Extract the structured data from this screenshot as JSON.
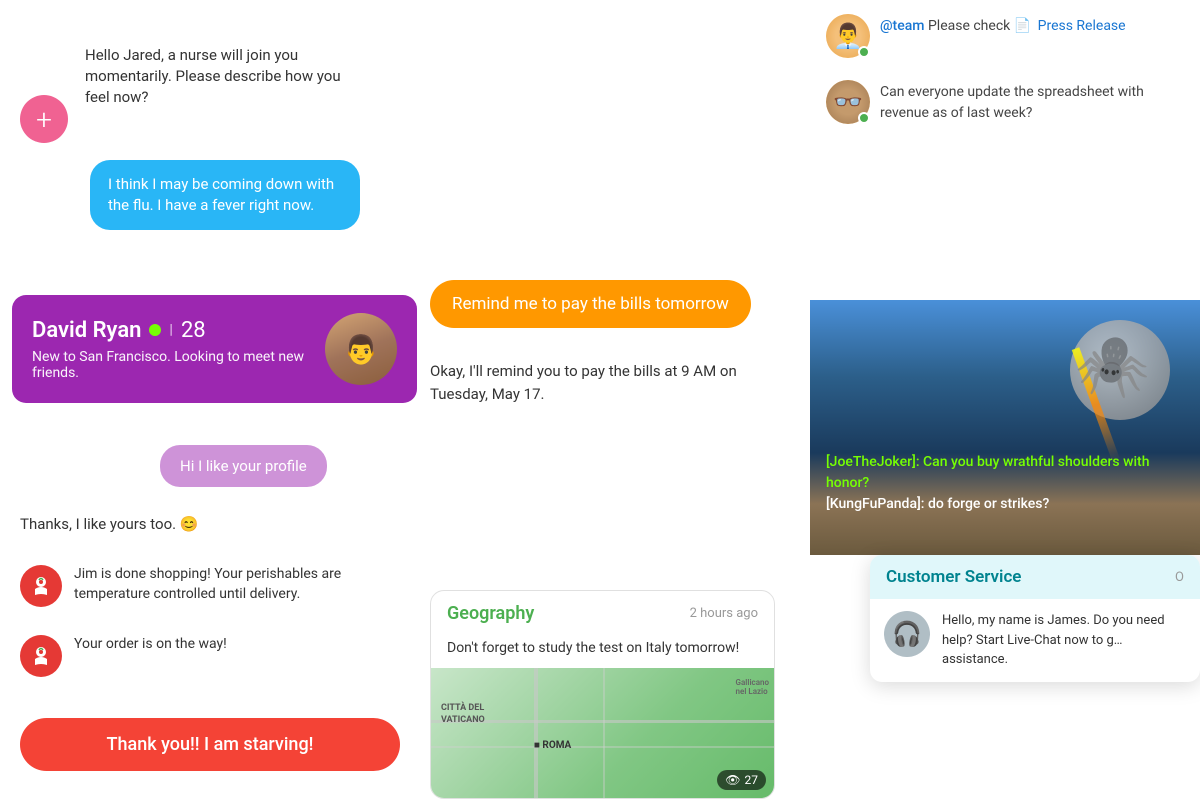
{
  "medicalChat": {
    "addBtn": "+",
    "nurseMsg": "Hello Jared, a nurse will join you momentarily. Please describe how you feel now?",
    "patientMsg": "I think I may be coming down with the flu. I have a fever right now.",
    "profileName": "David Ryan",
    "profileAge": "28",
    "profileBio": "New to San Francisco. Looking to meet new friends.",
    "hiMsg": "Hi I like your profile",
    "thanksMsg": "Thanks, I like yours too. 😊",
    "grocery1": "Jim is done shopping! Your perishables are temperature controlled until delivery.",
    "grocery2": "Your order is on the way!",
    "hungryBtn": "Thank you!! I am starving!"
  },
  "reminderChat": {
    "reminderRequest": "Remind me to pay the bills tomorrow",
    "reminderReply": "Okay, I'll remind you to pay the bills at 9 AM on Tuesday, May 17."
  },
  "geographyCard": {
    "title": "Geography",
    "timeAgo": "2 hours ago",
    "message": "Don't forget to study the test on Italy tomorrow!",
    "mapLabels": {
      "cittaVaticano": "CITTÀ DEL VATICANO",
      "roma": "■ ROMA"
    },
    "viewCount": "27"
  },
  "teamChat": {
    "message1": {
      "mention": "@team",
      "text": " Please check ",
      "linkIcon": "📄",
      "linkText": "Press Release"
    },
    "message2": {
      "text": "Can everyone update the spreadsheet with revenue as of last week?"
    }
  },
  "gameChat": {
    "line1": "[JoeTheJoker]: Can you buy wrathful shoulders with honor?",
    "line2": "[KungFuPanda]: do forge or strikes?"
  },
  "customerService": {
    "title": "Customer Service",
    "status": "O",
    "agentName": "James",
    "greeting": "Hello, my name is James. Do you need help? Start Live-Chat now to g… assistance."
  }
}
